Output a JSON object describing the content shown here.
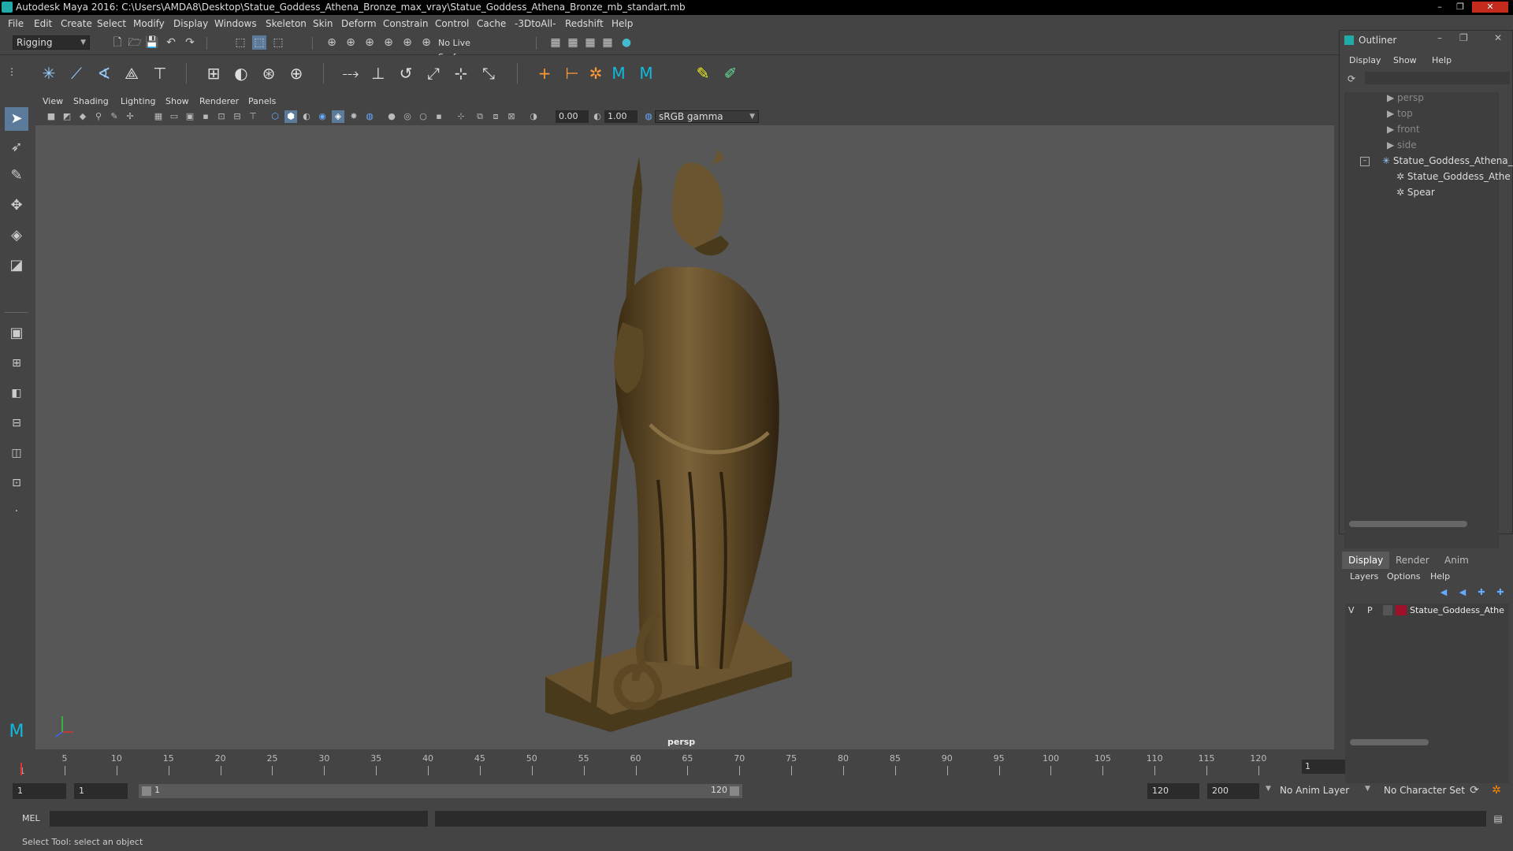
{
  "window": {
    "title": "Autodesk Maya 2016: C:\\Users\\AMDA8\\Desktop\\Statue_Goddess_Athena_Bronze_max_vray\\Statue_Goddess_Athena_Bronze_mb_standart.mb",
    "minimize": "–",
    "maximize": "❐",
    "close": "✕"
  },
  "menubar": [
    "File",
    "Edit",
    "Create",
    "Select",
    "Modify",
    "Display",
    "Windows",
    "Skeleton",
    "Skin",
    "Deform",
    "Constrain",
    "Control",
    "Cache",
    "-3DtoAll-",
    "Redshift",
    "Help"
  ],
  "statusline": {
    "menuset": "Rigging",
    "live_surface": "No Live Surface"
  },
  "viewport": {
    "menus": [
      "View",
      "Shading",
      "Lighting",
      "Show",
      "Renderer",
      "Panels"
    ],
    "exposure": "0.00",
    "gamma": "1.00",
    "colorspace": "sRGB gamma",
    "camera_label": "persp",
    "axis_labels": {
      "x": "x",
      "y": "y",
      "z": "z"
    },
    "colors": {
      "background": "#575757",
      "statue": "#6b5530"
    }
  },
  "timeline": {
    "ticks": [
      "5",
      "10",
      "15",
      "20",
      "25",
      "30",
      "35",
      "40",
      "45",
      "50",
      "55",
      "60",
      "65",
      "70",
      "75",
      "80",
      "85",
      "90",
      "95",
      "100",
      "105",
      "110",
      "115",
      "120"
    ],
    "start_label": "1",
    "current_frame": "1"
  },
  "range": {
    "start": "1",
    "playback_start": "1",
    "slider_start": "1",
    "slider_end": "120",
    "playback_end": "120",
    "end": "200",
    "anim_layer": "No Anim Layer",
    "character_set": "No Character Set"
  },
  "commandline": {
    "label": "MEL"
  },
  "helpline": {
    "text": "Select Tool: select an object"
  },
  "outliner": {
    "title": "Outliner",
    "menus": [
      "Display",
      "Show",
      "Help"
    ],
    "items": [
      {
        "label": "persp",
        "dim": true
      },
      {
        "label": "top",
        "dim": true
      },
      {
        "label": "front",
        "dim": true
      },
      {
        "label": "side",
        "dim": true
      },
      {
        "label": "Statue_Goddess_Athena_",
        "dim": false
      },
      {
        "label": "Statue_Goddess_Athe",
        "dim": false
      },
      {
        "label": "Spear",
        "dim": false
      }
    ]
  },
  "layer_editor": {
    "tabs": [
      "Display",
      "Render",
      "Anim"
    ],
    "menus": [
      "Layers",
      "Options",
      "Help"
    ],
    "layer": {
      "v": "V",
      "p": "P",
      "name": "Statue_Goddess_Athe",
      "color": "#a0102a"
    }
  }
}
